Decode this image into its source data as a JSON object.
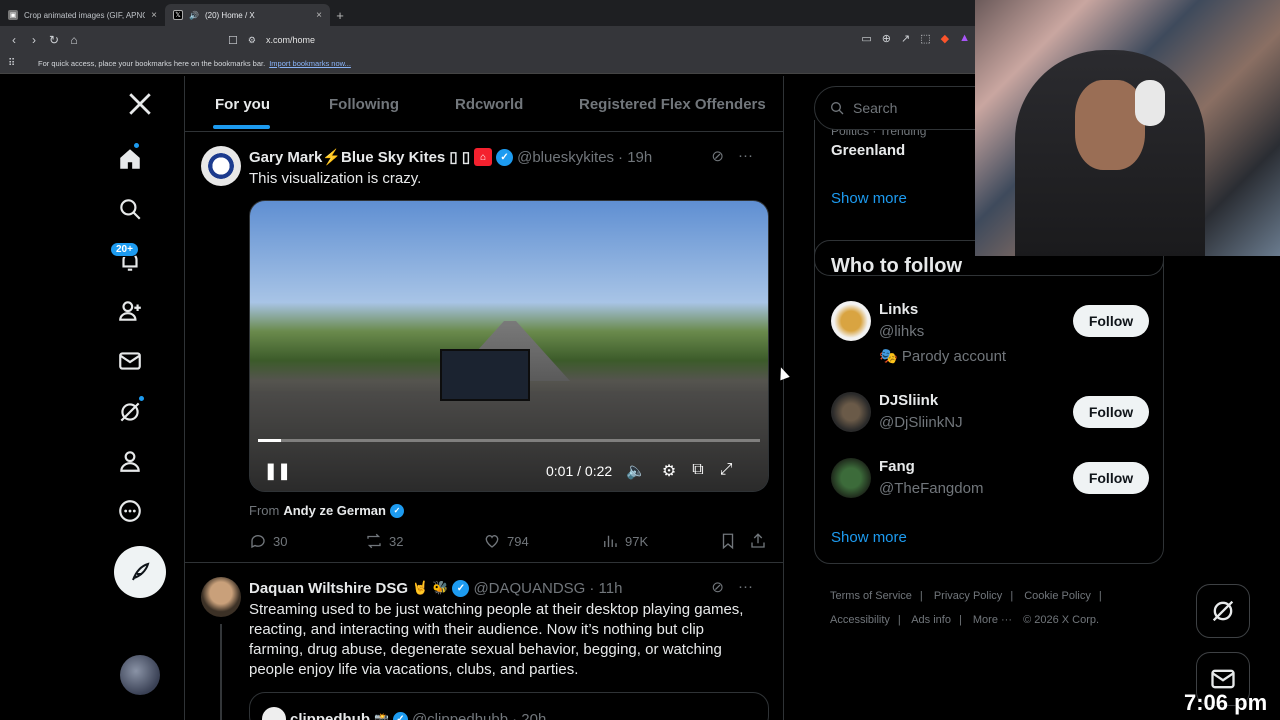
{
  "browser": {
    "tabs": [
      {
        "title": "Crop animated images (GIF, APNG, W",
        "active": false
      },
      {
        "title": "(20) Home / X",
        "active": true
      }
    ],
    "url": "x.com/home",
    "bookmarks_hint": "For quick access, place your bookmarks here on the bookmarks bar.",
    "bookmarks_link": "Import bookmarks now..."
  },
  "nav": {
    "notifications_badge": "20+"
  },
  "feed_tabs": [
    "For you",
    "Following",
    "Rdcworld",
    "Registered Flex Offenders"
  ],
  "tweet1": {
    "name": "Gary Mark⚡Blue Sky Kites ▯ ▯",
    "handle": "@blueskykites",
    "time": "· 19h",
    "text": "This visualization is crazy.",
    "video": {
      "time": "0:01 / 0:22",
      "progress": 0.045
    },
    "from_label": "From",
    "from_name": "Andy ze German",
    "replies": "30",
    "reposts": "32",
    "likes": "794",
    "views": "97K"
  },
  "tweet2": {
    "name": "Daquan Wiltshire DSG",
    "handle": "@DAQUANDSG",
    "time": "· 11h",
    "text": "Streaming used to be just watching people at their desktop playing games, reacting, and interacting with their audience. Now it’s nothing but clip farming, drug abuse, degenerate sexual behavior, begging, or watching people enjoy life via vacations, clubs, and parties.",
    "quote_name": "clippedhub",
    "quote_handle": "@clippedhubb",
    "quote_time": "· 20h"
  },
  "sidebar": {
    "search_placeholder": "Search",
    "trend_meta": "Politics · Trending",
    "trend_name": "Greenland",
    "show_more": "Show more",
    "who_to_follow": "Who to follow",
    "follow_label": "Follow",
    "people": [
      {
        "name": "Links",
        "handle": "@lihks",
        "label": "Parody account"
      },
      {
        "name": "DJSliink",
        "handle": "@DjSliinkNJ"
      },
      {
        "name": "Fang",
        "handle": "@TheFangdom"
      }
    ],
    "show_more_2": "Show more",
    "footer": [
      "Terms of Service",
      "Privacy Policy",
      "Cookie Policy",
      "Accessibility",
      "Ads info",
      "More ···",
      "© 2026 X Corp."
    ]
  },
  "overlay": {
    "clock": "7:06 pm"
  },
  "colors": {
    "accent": "#1d9bf0",
    "background": "#000000",
    "border": "#2f3336"
  }
}
